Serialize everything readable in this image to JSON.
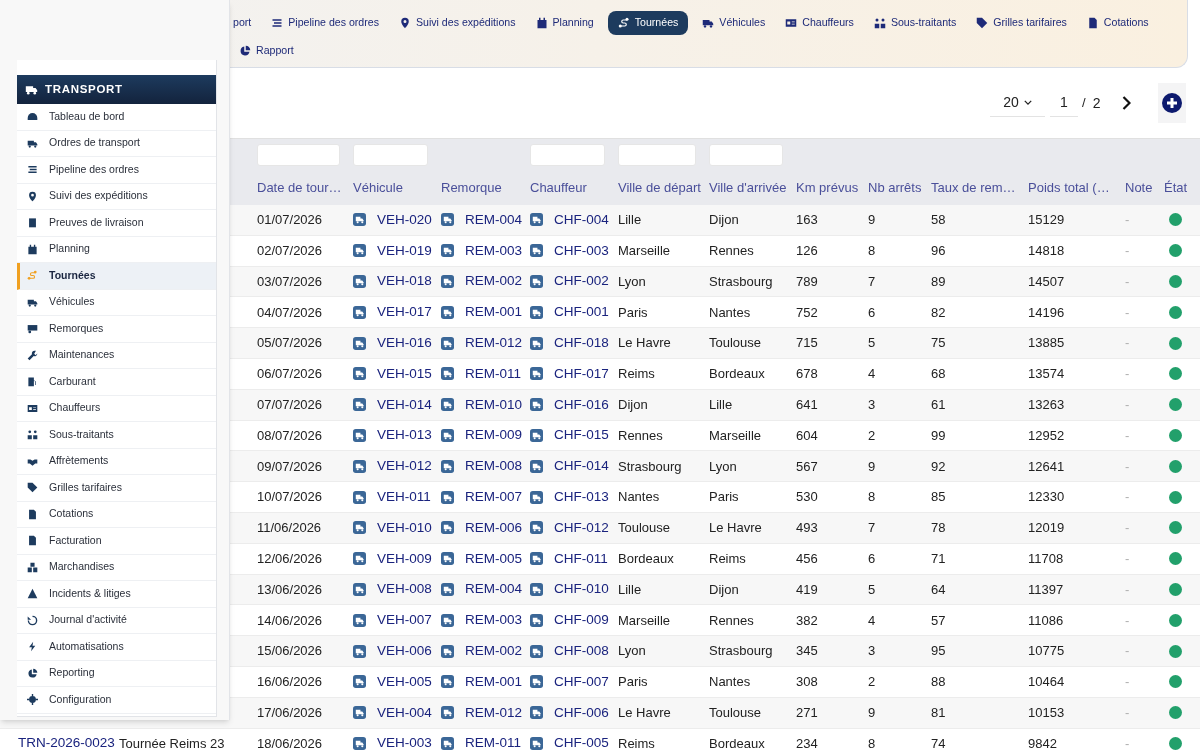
{
  "nav": {
    "rows": [
      [
        {
          "label": "port",
          "selected": false
        },
        {
          "label": "Pipeline des ordres",
          "selected": false
        },
        {
          "label": "Suivi des expéditions",
          "selected": false
        },
        {
          "label": "Planning",
          "selected": false
        },
        {
          "label": "Tournées",
          "selected": true
        },
        {
          "label": "Véhicules",
          "selected": false
        },
        {
          "label": "Chauffeurs",
          "selected": false
        },
        {
          "label": "Sous-traitants",
          "selected": false
        },
        {
          "label": "Grilles tarifaires",
          "selected": false
        },
        {
          "label": "Cotations",
          "selected": false
        }
      ],
      [
        {
          "label": "Rapport",
          "selected": false
        }
      ]
    ]
  },
  "pagination": {
    "page_size": "20",
    "page": "1",
    "separator": "/",
    "total": "2"
  },
  "sidebar": {
    "title": "TRANSPORT",
    "items": [
      {
        "label": "Tableau de bord",
        "selected": false
      },
      {
        "label": "Ordres de transport",
        "selected": false
      },
      {
        "label": "Pipeline des ordres",
        "selected": false
      },
      {
        "label": "Suivi des expéditions",
        "selected": false
      },
      {
        "label": "Preuves de livraison",
        "selected": false
      },
      {
        "label": "Planning",
        "selected": false
      },
      {
        "label": "Tournées",
        "selected": true
      },
      {
        "label": "Véhicules",
        "selected": false
      },
      {
        "label": "Remorques",
        "selected": false
      },
      {
        "label": "Maintenances",
        "selected": false
      },
      {
        "label": "Carburant",
        "selected": false
      },
      {
        "label": "Chauffeurs",
        "selected": false
      },
      {
        "label": "Sous-traitants",
        "selected": false
      },
      {
        "label": "Affrètements",
        "selected": false
      },
      {
        "label": "Grilles tarifaires",
        "selected": false
      },
      {
        "label": "Cotations",
        "selected": false
      },
      {
        "label": "Facturation",
        "selected": false
      },
      {
        "label": "Marchandises",
        "selected": false
      },
      {
        "label": "Incidents & litiges",
        "selected": false
      },
      {
        "label": "Journal d'activité",
        "selected": false
      },
      {
        "label": "Automatisations",
        "selected": false
      },
      {
        "label": "Reporting",
        "selected": false
      },
      {
        "label": "Configuration",
        "selected": false
      }
    ]
  },
  "table": {
    "columns": [
      {
        "kind": "link"
      },
      {
        "kind": "text"
      },
      {
        "label": "Date de tour…",
        "kind": "text",
        "filter": true
      },
      {
        "label": "Véhicule",
        "kind": "link",
        "filter": true
      },
      {
        "label": "Remorque",
        "kind": "link",
        "filter": false
      },
      {
        "label": "Chauffeur",
        "kind": "link",
        "filter": true
      },
      {
        "label": "Ville de départ",
        "kind": "text",
        "filter": true
      },
      {
        "label": "Ville d'arrivée",
        "kind": "text",
        "filter": true
      },
      {
        "label": "Km prévus",
        "kind": "text",
        "filter": false
      },
      {
        "label": "Nb arrêts",
        "kind": "text",
        "filter": false
      },
      {
        "label": "Taux de rem…",
        "kind": "text",
        "filter": false
      },
      {
        "label": "Poids total (…",
        "kind": "text",
        "filter": false
      },
      {
        "label": "Note",
        "kind": "muted",
        "filter": false
      },
      {
        "label": "État",
        "kind": "status",
        "filter": false
      }
    ],
    "rows": [
      {
        "cells": [
          null,
          null,
          "01/07/2026",
          "VEH-020",
          "REM-004",
          "CHF-004",
          "Lille",
          "Dijon",
          "163",
          "9",
          "58",
          "15129",
          "-"
        ],
        "color": "#22a06b"
      },
      {
        "cells": [
          null,
          null,
          "02/07/2026",
          "VEH-019",
          "REM-003",
          "CHF-003",
          "Marseille",
          "Rennes",
          "126",
          "8",
          "96",
          "14818",
          "-"
        ],
        "color": "#22a06b"
      },
      {
        "cells": [
          null,
          null,
          "03/07/2026",
          "VEH-018",
          "REM-002",
          "CHF-002",
          "Lyon",
          "Strasbourg",
          "789",
          "7",
          "89",
          "14507",
          "-"
        ],
        "color": "#22a06b"
      },
      {
        "cells": [
          null,
          null,
          "04/07/2026",
          "VEH-017",
          "REM-001",
          "CHF-001",
          "Paris",
          "Nantes",
          "752",
          "6",
          "82",
          "14196",
          "-"
        ],
        "color": "#22a06b"
      },
      {
        "cells": [
          null,
          null,
          "05/07/2026",
          "VEH-016",
          "REM-012",
          "CHF-018",
          "Le Havre",
          "Toulouse",
          "715",
          "5",
          "75",
          "13885",
          "-"
        ],
        "color": "#22a06b"
      },
      {
        "cells": [
          null,
          null,
          "06/07/2026",
          "VEH-015",
          "REM-011",
          "CHF-017",
          "Reims",
          "Bordeaux",
          "678",
          "4",
          "68",
          "13574",
          "-"
        ],
        "color": "#22a06b"
      },
      {
        "cells": [
          null,
          null,
          "07/07/2026",
          "VEH-014",
          "REM-010",
          "CHF-016",
          "Dijon",
          "Lille",
          "641",
          "3",
          "61",
          "13263",
          "-"
        ],
        "color": "#22a06b"
      },
      {
        "cells": [
          null,
          null,
          "08/07/2026",
          "VEH-013",
          "REM-009",
          "CHF-015",
          "Rennes",
          "Marseille",
          "604",
          "2",
          "99",
          "12952",
          "-"
        ],
        "color": "#22a06b"
      },
      {
        "cells": [
          null,
          null,
          "09/07/2026",
          "VEH-012",
          "REM-008",
          "CHF-014",
          "Strasbourg",
          "Lyon",
          "567",
          "9",
          "92",
          "12641",
          "-"
        ],
        "color": "#22a06b"
      },
      {
        "cells": [
          null,
          null,
          "10/07/2026",
          "VEH-011",
          "REM-007",
          "CHF-013",
          "Nantes",
          "Paris",
          "530",
          "8",
          "85",
          "12330",
          "-"
        ],
        "color": "#22a06b"
      },
      {
        "cells": [
          null,
          null,
          "11/06/2026",
          "VEH-010",
          "REM-006",
          "CHF-012",
          "Toulouse",
          "Le Havre",
          "493",
          "7",
          "78",
          "12019",
          "-"
        ],
        "color": "#22a06b"
      },
      {
        "cells": [
          null,
          null,
          "12/06/2026",
          "VEH-009",
          "REM-005",
          "CHF-011",
          "Bordeaux",
          "Reims",
          "456",
          "6",
          "71",
          "11708",
          "-"
        ],
        "color": "#22a06b"
      },
      {
        "cells": [
          null,
          null,
          "13/06/2026",
          "VEH-008",
          "REM-004",
          "CHF-010",
          "Lille",
          "Dijon",
          "419",
          "5",
          "64",
          "11397",
          "-"
        ],
        "color": "#22a06b"
      },
      {
        "cells": [
          null,
          null,
          "14/06/2026",
          "VEH-007",
          "REM-003",
          "CHF-009",
          "Marseille",
          "Rennes",
          "382",
          "4",
          "57",
          "11086",
          "-"
        ],
        "color": "#22a06b"
      },
      {
        "cells": [
          null,
          null,
          "15/06/2026",
          "VEH-006",
          "REM-002",
          "CHF-008",
          "Lyon",
          "Strasbourg",
          "345",
          "3",
          "95",
          "10775",
          "-"
        ],
        "color": "#22a06b"
      },
      {
        "cells": [
          null,
          null,
          "16/06/2026",
          "VEH-005",
          "REM-001",
          "CHF-007",
          "Paris",
          "Nantes",
          "308",
          "2",
          "88",
          "10464",
          "-"
        ],
        "color": "#22a06b"
      },
      {
        "cells": [
          null,
          null,
          "17/06/2026",
          "VEH-004",
          "REM-012",
          "CHF-006",
          "Le Havre",
          "Toulouse",
          "271",
          "9",
          "81",
          "10153",
          "-"
        ],
        "color": "#22a06b"
      },
      {
        "cells": [
          "TRN-2026-0023",
          "Tournée Reims 23",
          "18/06/2026",
          "VEH-003",
          "REM-011",
          "CHF-005",
          "Reims",
          "Bordeaux",
          "234",
          "8",
          "74",
          "9842",
          "-"
        ],
        "color": "#22a06b"
      }
    ]
  }
}
